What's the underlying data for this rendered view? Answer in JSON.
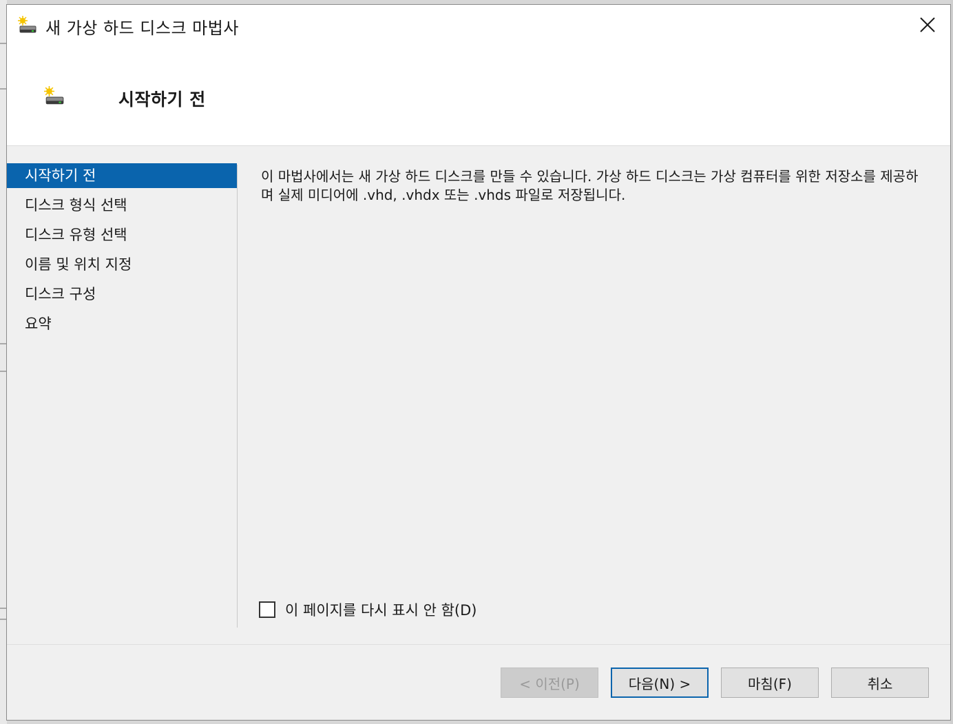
{
  "window": {
    "title": "새 가상 하드 디스크 마법사",
    "title_icon": "hard-disk-wizard-icon",
    "close_icon": "close-icon"
  },
  "header": {
    "title": "시작하기 전",
    "icon": "hard-disk-wizard-icon"
  },
  "nav": {
    "items": [
      {
        "label": "시작하기 전",
        "active": true
      },
      {
        "label": "디스크 형식 선택",
        "active": false
      },
      {
        "label": "디스크 유형 선택",
        "active": false
      },
      {
        "label": "이름 및 위치 지정",
        "active": false
      },
      {
        "label": "디스크 구성",
        "active": false
      },
      {
        "label": "요약",
        "active": false
      }
    ]
  },
  "content": {
    "description": "이 마법사에서는 새 가상 하드 디스크를 만들 수 있습니다. 가상 하드 디스크는 가상 컴퓨터를 위한 저장소를 제공하며 실제 미디어에 .vhd, .vhdx 또는 .vhds 파일로 저장됩니다.",
    "dont_show_again": {
      "label": "이 페이지를 다시 표시 안 함(D)",
      "checked": false
    }
  },
  "buttons": {
    "previous": "< 이전(P)",
    "next": "다음(N) >",
    "finish": "마침(F)",
    "cancel": "취소"
  },
  "colors": {
    "accent": "#0a64ad",
    "window_bg": "#f0f0f0",
    "header_bg": "#ffffff"
  }
}
